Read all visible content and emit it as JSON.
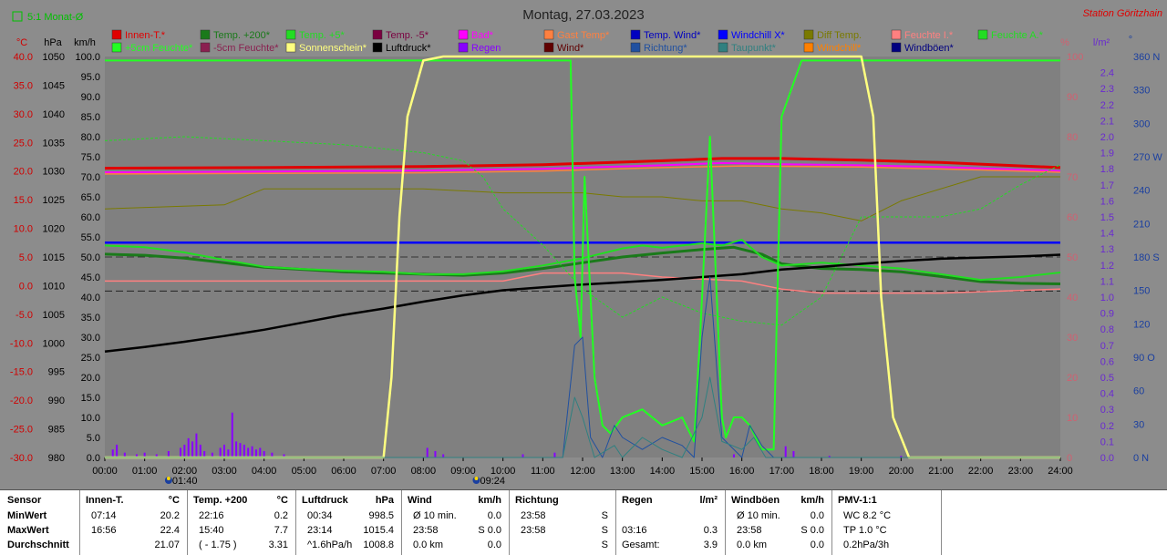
{
  "header": {
    "title": "Montag, 27.03.2023",
    "station": "Station Göritzhain",
    "toggle_label": "5:1 Monat-Ø"
  },
  "axis_units": {
    "temp": "°C",
    "hpa": "hPa",
    "kmh": "km/h",
    "pct": "%",
    "lm2": "l/m²",
    "deg": "°"
  },
  "chart_data": {
    "type": "line",
    "title": "Montag, 27.03.2023",
    "xlim": [
      0,
      24
    ],
    "x_ticks": [
      "00:00",
      "01:00",
      "02:00",
      "03:00",
      "04:00",
      "05:00",
      "06:00",
      "07:00",
      "08:00",
      "09:00",
      "10:00",
      "11:00",
      "12:00",
      "13:00",
      "14:00",
      "15:00",
      "16:00",
      "17:00",
      "18:00",
      "19:00",
      "20:00",
      "21:00",
      "22:00",
      "23:00",
      "24:00"
    ],
    "sun_events": [
      {
        "x": 1.67,
        "label": "01:40"
      },
      {
        "x": 9.4,
        "label": "09:24"
      }
    ],
    "axes": {
      "temp_c": {
        "ticks": [
          "40.0",
          "35.0",
          "30.0",
          "25.0",
          "20.0",
          "15.0",
          "10.0",
          "5.0",
          "0.0",
          "-5.0",
          "-10.0",
          "-15.0",
          "-20.0",
          "-25.0",
          "-30.0"
        ],
        "range": [
          -30,
          40
        ],
        "color": "#d00000"
      },
      "hpa": {
        "ticks": [
          "1050",
          "1045",
          "1040",
          "1035",
          "1030",
          "1025",
          "1020",
          "1015",
          "1010",
          "1005",
          "1000",
          "995",
          "990",
          "985",
          "980"
        ],
        "range": [
          980,
          1050
        ],
        "color": "#000000"
      },
      "kmh": {
        "ticks": [
          "100.0",
          "95.0",
          "90.0",
          "85.0",
          "80.0",
          "75.0",
          "70.0",
          "65.0",
          "60.0",
          "55.0",
          "50.0",
          "45.0",
          "40.0",
          "35.0",
          "30.0",
          "25.0",
          "20.0",
          "15.0",
          "10.0",
          "5.0",
          "0.0"
        ],
        "range": [
          0,
          100
        ],
        "color": "#000000"
      },
      "pct": {
        "ticks": [
          "100",
          "90",
          "80",
          "70",
          "60",
          "50",
          "40",
          "30",
          "20",
          "10",
          "0"
        ],
        "range": [
          0,
          100
        ],
        "color": "#d06070"
      },
      "lm2": {
        "ticks": [
          "2.4",
          "2.3",
          "2.2",
          "2.1",
          "2.0",
          "1.9",
          "1.8",
          "1.7",
          "1.6",
          "1.5",
          "1.4",
          "1.3",
          "1.2",
          "1.1",
          "1.0",
          "0.9",
          "0.8",
          "0.7",
          "0.6",
          "0.5",
          "0.4",
          "0.3",
          "0.2",
          "0.1",
          "0.0"
        ],
        "range": [
          0,
          2.5
        ],
        "color": "#6a2ad0"
      },
      "deg": {
        "ticks": [
          "360 N",
          "330",
          "300",
          "270 W",
          "240",
          "210",
          "180 S",
          "150",
          "120",
          "90 O",
          "60",
          "30",
          "0 N"
        ],
        "range": [
          0,
          360
        ],
        "color": "#1a3fa0"
      }
    },
    "legend": [
      {
        "name": "Innen-T.*",
        "color": "#e00000"
      },
      {
        "name": "Temp. +200*",
        "color": "#1a7a1a"
      },
      {
        "name": "Temp. +5*",
        "color": "#22dd22"
      },
      {
        "name": "Temp. -5*",
        "color": "#7a0040"
      },
      {
        "name": "Bad*",
        "color": "#ff00ff"
      },
      {
        "name": "Gast Temp*",
        "color": "#ff8040"
      },
      {
        "name": "Temp. Wind*",
        "color": "#0000c0"
      },
      {
        "name": "Windchill X*",
        "color": "#0000ff"
      },
      {
        "name": "Diff Temp.",
        "color": "#7a7a00"
      },
      {
        "name": "Feuchte I.*",
        "color": "#ff8080"
      },
      {
        "name": "Feuchte A.*",
        "color": "#22dd22"
      },
      {
        "name": "+5cm Feuchte*",
        "color": "#22ff22"
      },
      {
        "name": "-5cm Feuchte*",
        "color": "#8a2050"
      },
      {
        "name": "Sonnenschein*",
        "color": "#ffff80"
      },
      {
        "name": "Luftdruck*",
        "color": "#000000"
      },
      {
        "name": "Regen",
        "color": "#8800ff"
      },
      {
        "name": "Wind*",
        "color": "#600000"
      },
      {
        "name": "Richtung*",
        "color": "#2050a0"
      },
      {
        "name": "Taupunkt*",
        "color": "#308080"
      },
      {
        "name": "Windchill*",
        "color": "#ff8000"
      },
      {
        "name": "Windböen*",
        "color": "#000080"
      }
    ],
    "series": [
      {
        "name": "Innen-T.*",
        "color": "#e00000",
        "axis": "temp_c",
        "width": 3,
        "x": [
          0,
          4,
          8,
          11,
          14,
          15.5,
          17,
          19,
          21,
          24
        ],
        "y": [
          20.5,
          20.6,
          20.8,
          21.1,
          21.8,
          22.2,
          22.2,
          21.9,
          21.5,
          20.6
        ]
      },
      {
        "name": "Bad*",
        "color": "#ff00ff",
        "axis": "temp_c",
        "width": 2,
        "x": [
          0,
          4,
          8,
          11,
          14,
          15.5,
          17,
          19,
          21,
          24
        ],
        "y": [
          19.8,
          19.9,
          20.1,
          20.4,
          21.0,
          21.4,
          21.2,
          21.0,
          20.7,
          20.0
        ]
      },
      {
        "name": "Gast Temp*",
        "color": "#ff8040",
        "axis": "temp_c",
        "width": 1.5,
        "x": [
          0,
          4,
          8,
          11,
          14,
          16,
          19,
          22,
          24
        ],
        "y": [
          19.5,
          19.6,
          19.7,
          20.0,
          20.6,
          20.9,
          20.7,
          20.2,
          19.8
        ]
      },
      {
        "name": "Feuchte I.*",
        "color": "#ff8080",
        "axis": "pct",
        "width": 1.5,
        "x": [
          0,
          4,
          8,
          10,
          11,
          13,
          14,
          16,
          17,
          18,
          21,
          24
        ],
        "y": [
          44,
          44,
          44,
          44,
          46,
          46,
          45,
          44,
          42,
          41,
          41,
          42
        ]
      },
      {
        "name": "Diff Temp.",
        "color": "#7a7a00",
        "axis": "pct",
        "width": 1,
        "x": [
          0,
          3,
          4,
          6,
          8,
          10,
          11,
          12,
          13,
          14,
          15,
          16,
          17,
          18,
          19,
          20,
          22,
          24
        ],
        "y": [
          62,
          63,
          67,
          67,
          67,
          66,
          66,
          66,
          65,
          65,
          64,
          64,
          62,
          61,
          59,
          64,
          70,
          70
        ]
      },
      {
        "name": "Windchill X*",
        "color": "#0000ff",
        "axis": "temp_c",
        "width": 2.5,
        "x": [
          0,
          24
        ],
        "y": [
          7.5,
          7.5
        ]
      },
      {
        "name": "Temp. +200*",
        "color": "#1a7a1a",
        "axis": "temp_c",
        "width": 3,
        "x": [
          0,
          1,
          2,
          3,
          4,
          5,
          6,
          7,
          8,
          9,
          10,
          11,
          12,
          13,
          14,
          15,
          15.8,
          16.5,
          17,
          18,
          19,
          20,
          21,
          22,
          23,
          24
        ],
        "y": [
          5.5,
          5.3,
          4.8,
          4.0,
          3.2,
          2.8,
          2.4,
          2.2,
          2.0,
          1.8,
          2.2,
          3.0,
          4.0,
          5.0,
          5.7,
          6.3,
          6.7,
          5.5,
          3.8,
          3.0,
          2.8,
          2.4,
          1.6,
          0.7,
          0.4,
          0.3
        ]
      },
      {
        "name": "Temp. +5*",
        "color": "#22dd22",
        "axis": "temp_c",
        "width": 2,
        "x": [
          0,
          1,
          2,
          3,
          4,
          5,
          6,
          7,
          8,
          9,
          10,
          11,
          12,
          13,
          13.5,
          14,
          14.5,
          15,
          15.5,
          16,
          16.5,
          17,
          18,
          19,
          20,
          21,
          22,
          23,
          24
        ],
        "y": [
          7.0,
          6.7,
          5.8,
          4.5,
          3.3,
          2.9,
          2.6,
          2.4,
          2.0,
          2.0,
          2.5,
          3.5,
          4.8,
          6.5,
          7.0,
          6.6,
          7.0,
          7.4,
          7.0,
          8.0,
          5.0,
          3.5,
          4.0,
          3.5,
          3.0,
          2.0,
          1.0,
          1.5,
          2.3
        ]
      },
      {
        "name": "Feuchte A.*",
        "color": "#22dd22",
        "axis": "pct",
        "width": 1,
        "dash": "3,2",
        "x": [
          0,
          2,
          4,
          6,
          8,
          9,
          9.5,
          10,
          11,
          12,
          13,
          14,
          15,
          16,
          17,
          18,
          19,
          20,
          21,
          22,
          23,
          24
        ],
        "y": [
          79,
          80,
          79,
          78,
          76,
          74,
          70,
          62,
          53,
          42,
          35,
          40,
          36,
          34,
          33,
          40,
          60,
          60,
          60,
          62,
          68,
          73
        ]
      },
      {
        "name": "Luftdruck*",
        "color": "#000000",
        "axis": "hpa",
        "width": 2.5,
        "x": [
          0,
          1,
          2,
          3,
          4,
          5,
          6,
          7,
          8,
          9,
          10,
          11,
          12,
          13,
          14,
          15,
          16,
          17,
          18,
          19,
          20,
          21,
          22,
          23,
          24
        ],
        "y": [
          998.5,
          999.3,
          1000.2,
          1001.2,
          1002.3,
          1003.6,
          1004.9,
          1006.0,
          1007.2,
          1008.3,
          1009.2,
          1009.7,
          1010.2,
          1010.6,
          1011.0,
          1011.5,
          1012.0,
          1012.8,
          1013.3,
          1013.8,
          1014.3,
          1014.7,
          1014.9,
          1015.1,
          1015.4
        ]
      },
      {
        "name": "+5cm Feuchte*",
        "color": "#22ff22",
        "axis": "pct",
        "width": 2,
        "x": [
          0,
          11.7,
          11.8,
          11.95,
          12.05,
          12.3,
          12.5,
          12.7,
          13,
          13.5,
          14,
          14.5,
          14.8,
          14.95,
          15.2,
          15.5,
          15.6,
          15.8,
          16,
          16.2,
          16.5,
          16.8,
          17,
          17.5,
          19,
          24
        ],
        "y": [
          99,
          99,
          45,
          30,
          70,
          20,
          8,
          6,
          10,
          12,
          8,
          10,
          4,
          30,
          80,
          10,
          5,
          10,
          10,
          8,
          2,
          2,
          85,
          99,
          99,
          99
        ]
      },
      {
        "name": "Sonnenschein*",
        "color": "#ffff80",
        "axis": "pct",
        "width": 2.5,
        "x": [
          0,
          7.0,
          7.2,
          7.4,
          7.6,
          8.0,
          8.5,
          19.0,
          19.3,
          19.5,
          19.8,
          20.2,
          24
        ],
        "y": [
          0,
          0,
          20,
          60,
          85,
          99,
          100,
          100,
          85,
          40,
          10,
          0,
          0
        ]
      },
      {
        "name": "Richtung*",
        "color": "#2050a0",
        "axis": "pct",
        "width": 1,
        "x": [
          0,
          11.5,
          11.8,
          12.0,
          12.2,
          12.5,
          12.8,
          13,
          13.5,
          14,
          14.5,
          14.8,
          15,
          15.2,
          15.5,
          16,
          16.2,
          16.5,
          16.8,
          17,
          24
        ],
        "y": [
          0,
          0,
          28,
          30,
          5,
          0,
          8,
          5,
          2,
          5,
          3,
          0,
          30,
          45,
          5,
          0,
          8,
          3,
          0,
          0,
          0
        ]
      },
      {
        "name": "Taupunkt*",
        "color": "#308080",
        "axis": "pct",
        "width": 1,
        "x": [
          0,
          11.5,
          11.8,
          12.0,
          12.3,
          12.8,
          13,
          13.5,
          14,
          14.5,
          15,
          15.2,
          15.5,
          16,
          16.3,
          16.6,
          17,
          24
        ],
        "y": [
          0,
          0,
          15,
          10,
          0,
          3,
          0,
          5,
          2,
          0,
          10,
          20,
          4,
          2,
          5,
          0,
          0,
          0
        ]
      }
    ],
    "rain": {
      "axis": "lm2",
      "bars": [
        [
          0.2,
          0.05
        ],
        [
          0.3,
          0.08
        ],
        [
          0.5,
          0.03
        ],
        [
          0.8,
          0.02
        ],
        [
          1.0,
          0.03
        ],
        [
          1.3,
          0.02
        ],
        [
          1.6,
          0.04
        ],
        [
          1.9,
          0.06
        ],
        [
          2.0,
          0.08
        ],
        [
          2.1,
          0.12
        ],
        [
          2.2,
          0.1
        ],
        [
          2.3,
          0.15
        ],
        [
          2.4,
          0.08
        ],
        [
          2.5,
          0.04
        ],
        [
          2.7,
          0.03
        ],
        [
          2.9,
          0.06
        ],
        [
          3.0,
          0.08
        ],
        [
          3.1,
          0.05
        ],
        [
          3.2,
          0.28
        ],
        [
          3.3,
          0.1
        ],
        [
          3.4,
          0.09
        ],
        [
          3.5,
          0.08
        ],
        [
          3.6,
          0.06
        ],
        [
          3.7,
          0.07
        ],
        [
          3.8,
          0.05
        ],
        [
          3.9,
          0.06
        ],
        [
          4.0,
          0.04
        ],
        [
          4.2,
          0.03
        ],
        [
          4.5,
          0.02
        ],
        [
          7.0,
          0.01
        ],
        [
          8.1,
          0.06
        ],
        [
          8.3,
          0.04
        ],
        [
          8.5,
          0.02
        ],
        [
          10.5,
          0.02
        ],
        [
          11.3,
          0.03
        ],
        [
          15.8,
          0.02
        ],
        [
          17.1,
          0.07
        ],
        [
          17.3,
          0.04
        ],
        [
          18.2,
          0.01
        ],
        [
          20.0,
          0.01
        ]
      ]
    },
    "reflines": [
      {
        "axis": "kmh",
        "y": 50,
        "color": "#333333",
        "dash": "8,4"
      },
      {
        "axis": "kmh",
        "y": 41.5,
        "color": "#222222",
        "dash": "8,4"
      }
    ]
  },
  "stats": {
    "row_labels": [
      "Sensor",
      "MinWert",
      "MaxWert",
      "Durchschnitt"
    ],
    "sections": [
      {
        "title": "Innen-T.",
        "unit": "°C",
        "rows": [
          [
            "07:14",
            "20.2"
          ],
          [
            "16:56",
            "22.4"
          ],
          [
            "",
            "21.07"
          ]
        ]
      },
      {
        "title": "Temp. +200",
        "unit": "°C",
        "rows": [
          [
            "22:16",
            "0.2"
          ],
          [
            "15:40",
            "7.7"
          ],
          [
            "( - 1.75 )",
            "3.31"
          ]
        ]
      },
      {
        "title": "Luftdruck",
        "unit": "hPa",
        "rows": [
          [
            "00:34",
            "998.5"
          ],
          [
            "23:14",
            "1015.4"
          ],
          [
            "^1.6hPa/h",
            "1008.8"
          ]
        ]
      },
      {
        "title": "Wind",
        "unit": "km/h",
        "rows": [
          [
            "Ø 10 min.",
            "0.0"
          ],
          [
            "23:58",
            "S 0.0"
          ],
          [
            "0.0 km",
            "0.0"
          ]
        ]
      },
      {
        "title": "Richtung",
        "unit": "",
        "rows": [
          [
            "23:58",
            "S"
          ],
          [
            "23:58",
            "S"
          ],
          [
            "",
            "S"
          ]
        ]
      },
      {
        "title": "Regen",
        "unit": "l/m²",
        "rows": [
          [
            "",
            ""
          ],
          [
            "03:16",
            "0.3"
          ],
          [
            "Gesamt:",
            "3.9"
          ]
        ]
      },
      {
        "title": "Windböen",
        "unit": "km/h",
        "rows": [
          [
            "Ø 10 min.",
            "0.0"
          ],
          [
            "23:58",
            "S 0.0"
          ],
          [
            "0.0 km",
            "0.0"
          ]
        ]
      },
      {
        "title": "PMV-1:1",
        "unit": "",
        "rows": [
          [
            "WC 8.2 °C",
            ""
          ],
          [
            "TP 1.0 °C",
            ""
          ],
          [
            "0.2hPa/3h",
            ""
          ]
        ]
      }
    ]
  }
}
